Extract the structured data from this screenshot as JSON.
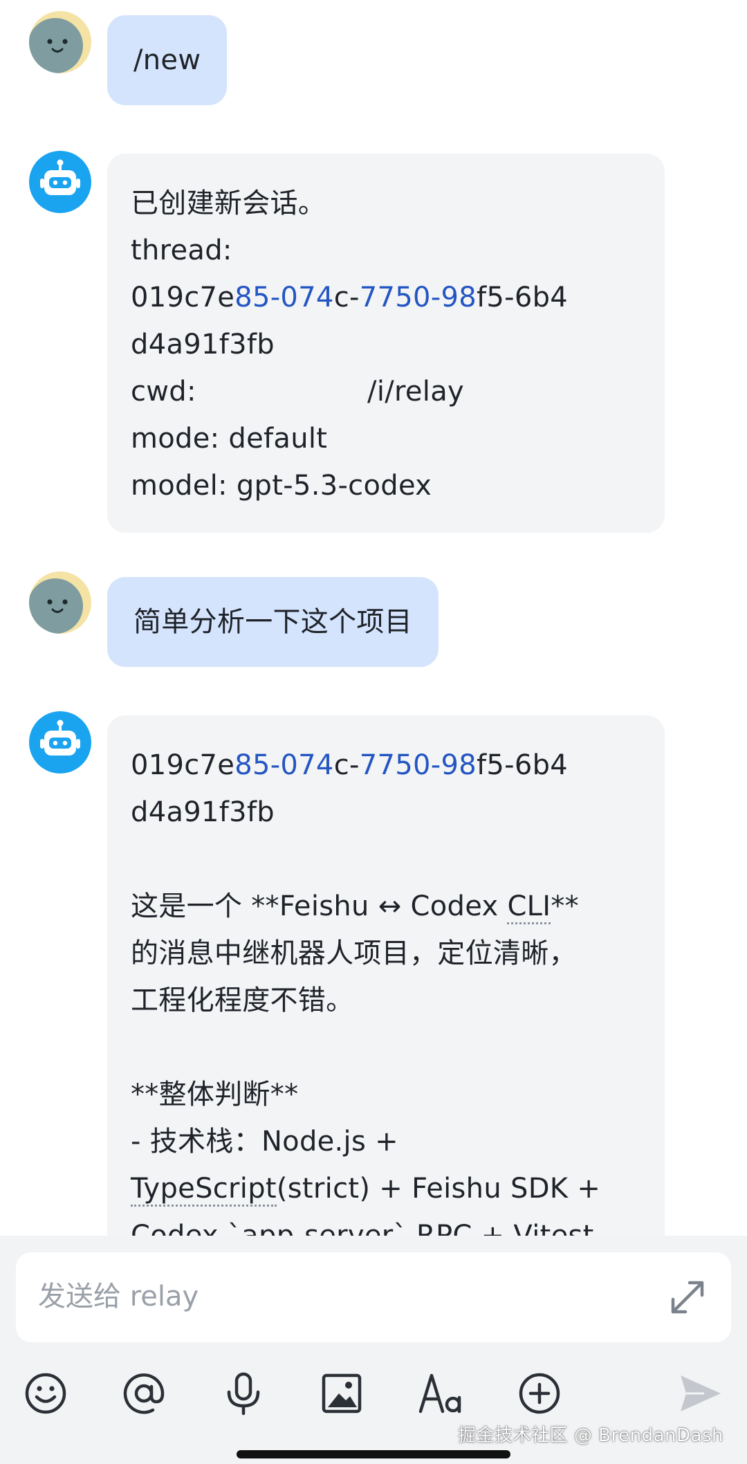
{
  "messages": [
    {
      "role": "user",
      "text": "/new"
    },
    {
      "role": "bot",
      "lines": [
        "已创建新会话。",
        "thread:",
        [
          "019c7e",
          "85-074",
          "c-",
          "7750-98",
          "f5-6b4"
        ],
        "d4a91f3fb",
        "cwd:                   /i/relay",
        "mode: default",
        "model: gpt-5.3-codex"
      ]
    },
    {
      "role": "user",
      "text": "简单分析一下这个项目"
    },
    {
      "role": "bot",
      "lines": [
        [
          "019c7e",
          "85-074",
          "c-",
          "7750-98",
          "f5-6b4"
        ],
        "d4a91f3fb",
        "",
        [
          "这是一个 **Feishu ↔ Codex ",
          "CLI",
          "**"
        ],
        "的消息中继机器人项目，定位清晰，",
        "工程化程度不错。",
        "",
        "**整体判断**",
        "- 技术栈：Node.js +",
        [
          "TypeScript",
          "(strict) + Feishu SDK +"
        ],
        "Codex `app-server` RPC + Vitest"
      ]
    }
  ],
  "composer": {
    "placeholder": "发送给 relay",
    "expand_icon": "expand-arrows-icon"
  },
  "toolbar": {
    "icons": [
      "emoji-icon",
      "mention-icon",
      "microphone-icon",
      "image-icon",
      "text-format-icon",
      "add-icon",
      "send-icon"
    ]
  },
  "watermark": "掘金技术社区 @ BrendanDash",
  "colors": {
    "user_bubble": "#d4e4fd",
    "bot_bubble": "#f3f4f6",
    "link_blue": "#2456c2",
    "bot_avatar": "#1aa4f0",
    "composer_bg": "#f2f3f5"
  }
}
